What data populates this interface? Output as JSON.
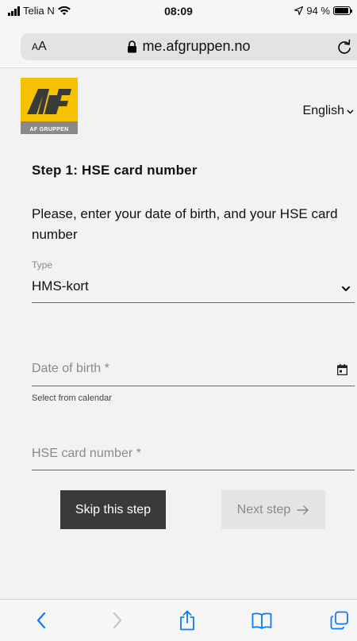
{
  "status_bar": {
    "carrier": "Telia N",
    "time": "08:09",
    "battery_text": "94 %",
    "battery_level": 0.94
  },
  "browser": {
    "text_size_label": "AA",
    "url": "me.afgruppen.no"
  },
  "header": {
    "logo_caption": "AF GRUPPEN",
    "language": "English"
  },
  "form": {
    "step_title": "Step 1: HSE card number",
    "instruction": "Please, enter your date of birth, and your HSE card number",
    "type_label": "Type",
    "type_value": "HMS-kort",
    "dob_placeholder": "Date of birth *",
    "dob_helper": "Select from calendar",
    "hse_placeholder": "HSE card number *",
    "skip_label": "Skip this step",
    "next_label": "Next step"
  },
  "colors": {
    "brand_yellow": "#f5c100",
    "brand_grey": "#8a8a8a",
    "skip_button": "#3a3a3a",
    "next_button_disabled": "#e4e4e4",
    "ios_blue": "#0a7aff"
  },
  "icons": {
    "toolbar": [
      "back-icon",
      "forward-icon",
      "share-icon",
      "bookmarks-icon",
      "tabs-icon"
    ]
  }
}
